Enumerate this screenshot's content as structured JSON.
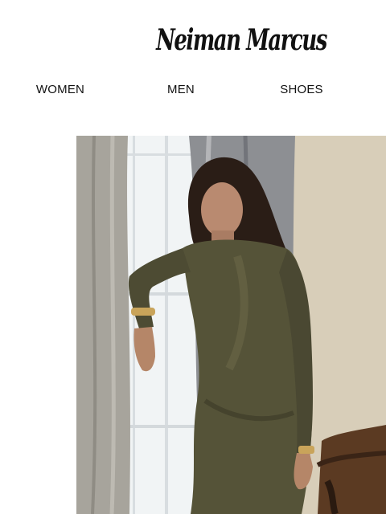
{
  "brand": {
    "logo_text": "Neiman Marcus"
  },
  "nav": {
    "items": [
      {
        "label": "WOMEN"
      },
      {
        "label": "MEN"
      },
      {
        "label": "SHOES"
      }
    ]
  },
  "hero": {
    "subject": "woman-in-olive-metallic-knit-dress-by-window",
    "colors": {
      "curtain": "#a6a39b",
      "window": "#f2f5f6",
      "wall": "#d8ceb9",
      "dress": "#545238",
      "skin": "#b98a70",
      "hair": "#2a1d16",
      "furniture": "#5b3a22"
    }
  }
}
